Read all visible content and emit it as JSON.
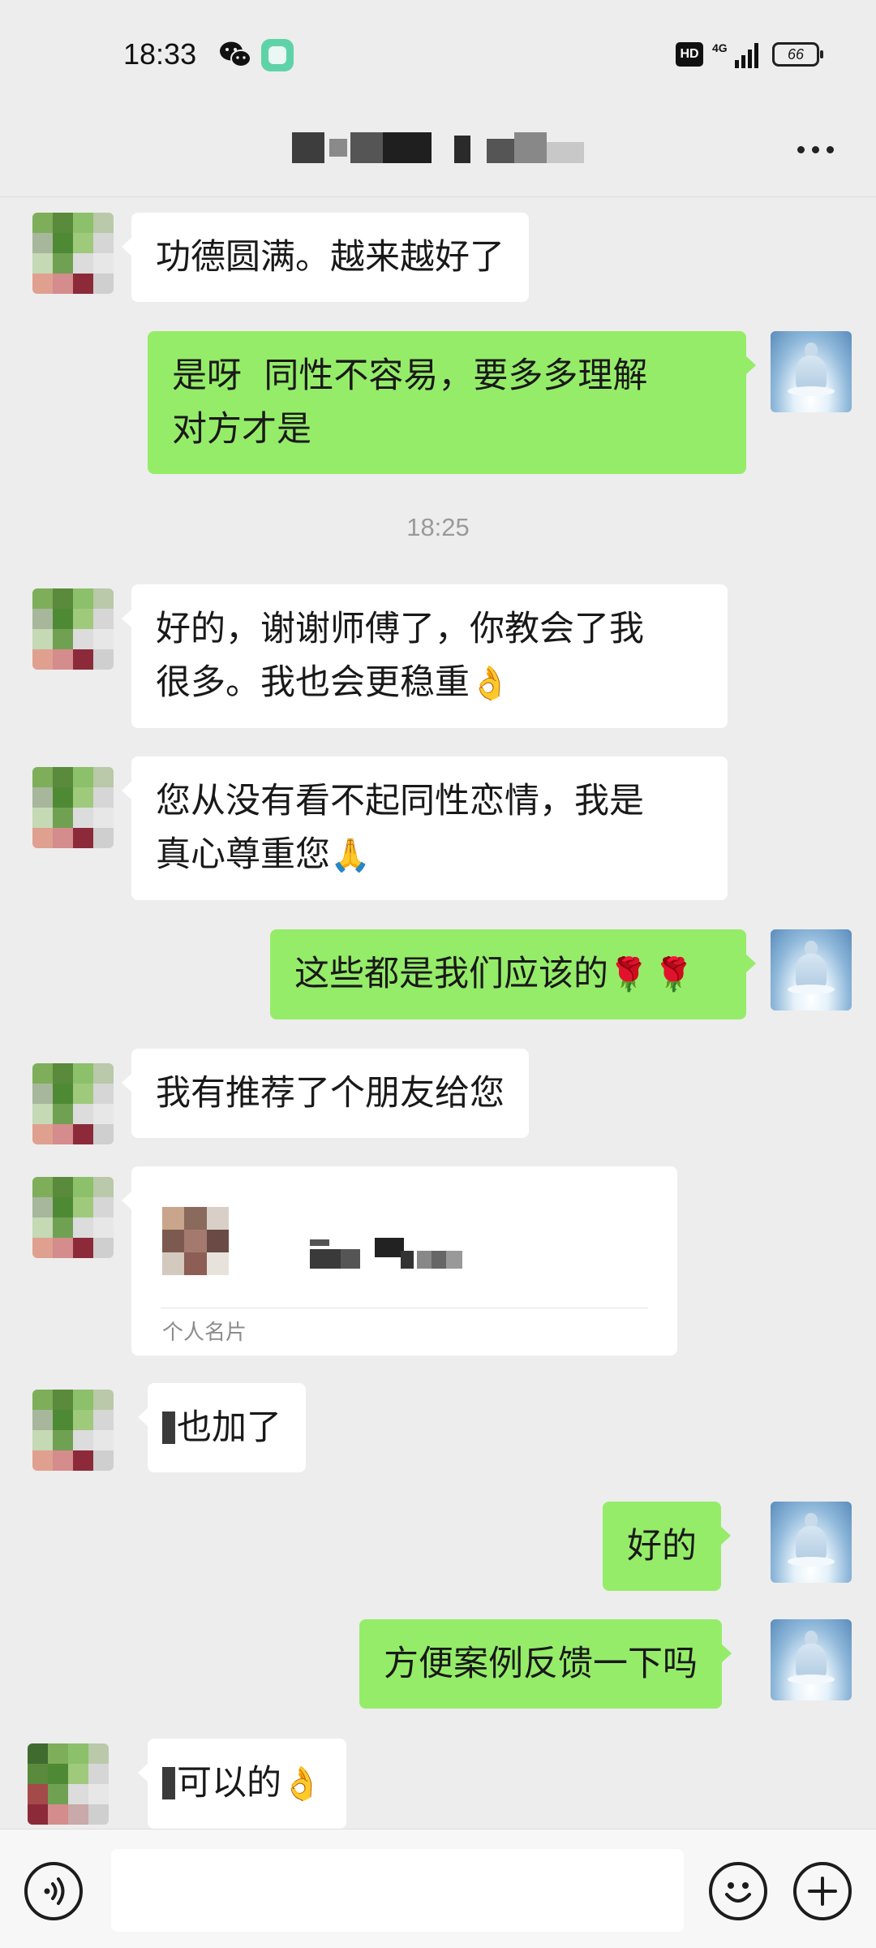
{
  "status_bar": {
    "time": "18:33",
    "network": "4G",
    "hd_label": "HD",
    "battery": "66",
    "icons": [
      "wechat-icon",
      "app-icon",
      "hd-icon",
      "signal-icon",
      "battery-icon"
    ]
  },
  "header": {
    "title_obscured": true,
    "more_icon": "more-icon"
  },
  "timestamp": "18:25",
  "messages": [
    {
      "side": "in",
      "text": "功德圆满。越来越好了"
    },
    {
      "side": "out",
      "lines": [
        "是呀  同性不容易，要多多理解",
        "对方才是"
      ]
    },
    {
      "side": "in",
      "lines": [
        "好的，谢谢师傅了，你教会了我",
        "很多。我也会更稳重"
      ],
      "emoji": "👌"
    },
    {
      "side": "in",
      "lines": [
        "您从没有看不起同性恋情，我是",
        "真心尊重您"
      ],
      "emoji": "🙏"
    },
    {
      "side": "out",
      "text": "这些都是我们应该的",
      "emoji": "🌹🌹"
    },
    {
      "side": "in",
      "text": "我有推荐了个朋友给您"
    },
    {
      "side": "in",
      "type": "contact_card",
      "footer": "个人名片"
    },
    {
      "side": "in",
      "text": "也加了",
      "partially_obscured": true
    },
    {
      "side": "out",
      "text": "好的"
    },
    {
      "side": "out",
      "text": "方便案例反馈一下吗"
    },
    {
      "side": "in",
      "text": "可以的",
      "emoji": "👌",
      "partially_obscured": true
    }
  ],
  "input_bar": {
    "voice_icon": "voice-icon",
    "emoji_icon": "emoji-icon",
    "plus_icon": "plus-icon",
    "field_value": ""
  },
  "colors": {
    "background": "#ededed",
    "incoming_bubble": "#ffffff",
    "outgoing_bubble": "#95ec69",
    "timestamp": "#9a9a9a"
  }
}
